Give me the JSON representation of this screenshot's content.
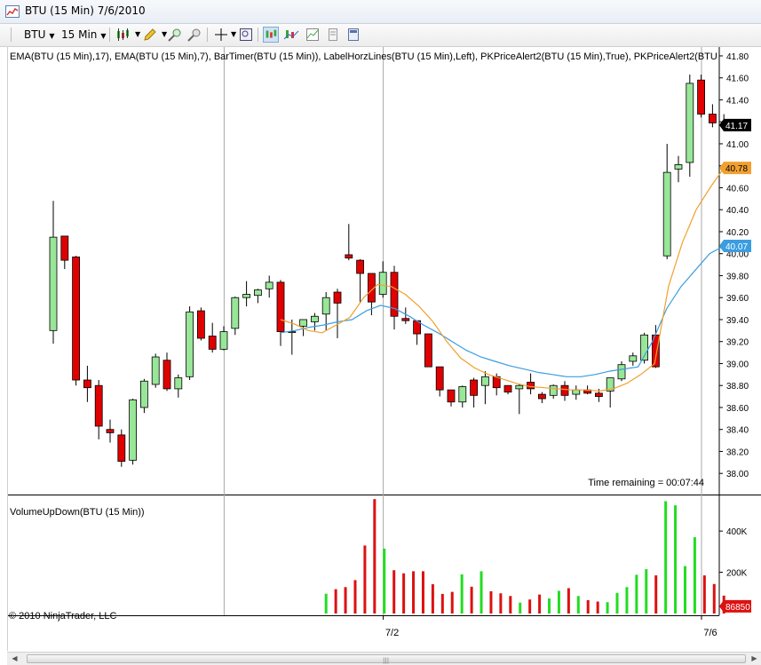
{
  "window": {
    "title": "BTU (15 Min)  7/6/2010"
  },
  "toolbar": {
    "instrument": "BTU",
    "interval": "15 Min"
  },
  "price_panel": {
    "indicator_label": "EMA(BTU (15 Min),17), EMA(BTU (15 Min),7), BarTimer(BTU (15 Min)), LabelHorzLines(BTU (15 Min),Left), PKPriceAlert2(BTU (15 Min),True), PKPriceAlert2(BTU",
    "time_remaining": "Time remaining = 00:07:44",
    "last_price_label": "41.17",
    "ema7_label": "40.78",
    "ema17_label": "40.07",
    "y_ticks": [
      "41.80",
      "41.60",
      "41.40",
      "41.20",
      "41.00",
      "40.80",
      "40.60",
      "40.40",
      "40.20",
      "40.00",
      "39.80",
      "39.60",
      "39.40",
      "39.20",
      "39.00",
      "38.80",
      "38.60",
      "38.40",
      "38.20",
      "38.00"
    ]
  },
  "volume_panel": {
    "label": "VolumeUpDown(BTU (15 Min))",
    "copyright": "© 2010 NinjaTrader, LLC",
    "last_volume_label": "86850",
    "y_ticks": [
      "400K",
      "200K"
    ]
  },
  "x_axis": {
    "labels": [
      "7/2",
      "7/6"
    ]
  },
  "colors": {
    "up": "#98e698",
    "down": "#e00000",
    "ema_fast": "#f0a030",
    "ema_slow": "#3b9de0",
    "vol_up": "#22dd22",
    "vol_down": "#dd1111",
    "last_price_bg": "#000000",
    "ema_fast_bg": "#f0a030",
    "ema_slow_bg": "#3b9de0",
    "volume_label_bg": "#dd1111"
  },
  "chart_data": {
    "type": "candlestick",
    "price_range": [
      37.84,
      41.84
    ],
    "volume_range": [
      0,
      560000
    ],
    "separators": [
      15,
      29,
      57
    ],
    "candles": [
      {
        "o": 39.3,
        "h": 40.48,
        "l": 39.18,
        "c": 40.15
      },
      {
        "o": 40.16,
        "h": 40.16,
        "l": 39.86,
        "c": 39.94
      },
      {
        "o": 39.97,
        "h": 39.98,
        "l": 38.8,
        "c": 38.85
      },
      {
        "o": 38.85,
        "h": 38.98,
        "l": 38.65,
        "c": 38.78
      },
      {
        "o": 38.8,
        "h": 38.85,
        "l": 38.31,
        "c": 38.43
      },
      {
        "o": 38.4,
        "h": 38.49,
        "l": 38.28,
        "c": 38.37
      },
      {
        "o": 38.35,
        "h": 38.4,
        "l": 38.06,
        "c": 38.11
      },
      {
        "o": 38.12,
        "h": 38.68,
        "l": 38.08,
        "c": 38.67
      },
      {
        "o": 38.6,
        "h": 38.86,
        "l": 38.55,
        "c": 38.84
      },
      {
        "o": 38.81,
        "h": 39.09,
        "l": 38.78,
        "c": 39.06
      },
      {
        "o": 39.03,
        "h": 39.1,
        "l": 38.75,
        "c": 38.77
      },
      {
        "o": 38.77,
        "h": 38.9,
        "l": 38.69,
        "c": 38.87
      },
      {
        "o": 38.88,
        "h": 39.52,
        "l": 38.85,
        "c": 39.47
      },
      {
        "o": 39.48,
        "h": 39.51,
        "l": 39.21,
        "c": 39.23
      },
      {
        "o": 39.25,
        "h": 39.37,
        "l": 39.1,
        "c": 39.13
      },
      {
        "o": 39.13,
        "h": 39.34,
        "l": 39.12,
        "c": 39.29
      },
      {
        "o": 39.32,
        "h": 39.61,
        "l": 39.26,
        "c": 39.6
      },
      {
        "o": 39.6,
        "h": 39.75,
        "l": 39.52,
        "c": 39.63
      },
      {
        "o": 39.62,
        "h": 39.68,
        "l": 39.55,
        "c": 39.67
      },
      {
        "o": 39.68,
        "h": 39.8,
        "l": 39.6,
        "c": 39.74
      },
      {
        "o": 39.74,
        "h": 39.76,
        "l": 39.16,
        "c": 39.29
      },
      {
        "o": 39.29,
        "h": 39.4,
        "l": 39.08,
        "c": 39.29
      },
      {
        "o": 39.34,
        "h": 39.4,
        "l": 39.25,
        "c": 39.4
      },
      {
        "o": 39.38,
        "h": 39.46,
        "l": 39.3,
        "c": 39.43
      },
      {
        "o": 39.45,
        "h": 39.65,
        "l": 39.3,
        "c": 39.6
      },
      {
        "o": 39.65,
        "h": 39.68,
        "l": 39.23,
        "c": 39.55
      },
      {
        "o": 39.99,
        "h": 40.27,
        "l": 39.94,
        "c": 39.96
      },
      {
        "o": 39.94,
        "h": 39.95,
        "l": 39.55,
        "c": 39.82
      },
      {
        "o": 39.82,
        "h": 39.82,
        "l": 39.44,
        "c": 39.56
      },
      {
        "o": 39.63,
        "h": 39.93,
        "l": 39.6,
        "c": 39.83
      },
      {
        "o": 39.83,
        "h": 39.89,
        "l": 39.31,
        "c": 39.43
      },
      {
        "o": 39.41,
        "h": 39.51,
        "l": 39.36,
        "c": 39.39
      },
      {
        "o": 39.39,
        "h": 39.39,
        "l": 39.17,
        "c": 39.27
      },
      {
        "o": 39.27,
        "h": 39.27,
        "l": 38.99,
        "c": 38.97
      },
      {
        "o": 38.97,
        "h": 38.97,
        "l": 38.7,
        "c": 38.76
      },
      {
        "o": 38.76,
        "h": 38.76,
        "l": 38.61,
        "c": 38.65
      },
      {
        "o": 38.65,
        "h": 38.8,
        "l": 38.6,
        "c": 38.79
      },
      {
        "o": 38.85,
        "h": 38.87,
        "l": 38.6,
        "c": 38.71
      },
      {
        "o": 38.8,
        "h": 38.93,
        "l": 38.63,
        "c": 38.88
      },
      {
        "o": 38.88,
        "h": 38.91,
        "l": 38.71,
        "c": 38.78
      },
      {
        "o": 38.8,
        "h": 38.8,
        "l": 38.72,
        "c": 38.74
      },
      {
        "o": 38.77,
        "h": 38.81,
        "l": 38.54,
        "c": 38.8
      },
      {
        "o": 38.83,
        "h": 38.91,
        "l": 38.72,
        "c": 38.77
      },
      {
        "o": 38.72,
        "h": 38.74,
        "l": 38.64,
        "c": 38.68
      },
      {
        "o": 38.71,
        "h": 38.81,
        "l": 38.68,
        "c": 38.8
      },
      {
        "o": 38.8,
        "h": 38.84,
        "l": 38.66,
        "c": 38.71
      },
      {
        "o": 38.72,
        "h": 38.8,
        "l": 38.67,
        "c": 38.76
      },
      {
        "o": 38.76,
        "h": 38.8,
        "l": 38.72,
        "c": 38.73
      },
      {
        "o": 38.73,
        "h": 38.77,
        "l": 38.65,
        "c": 38.7
      },
      {
        "o": 38.75,
        "h": 38.87,
        "l": 38.6,
        "c": 38.87
      },
      {
        "o": 38.86,
        "h": 39.02,
        "l": 38.84,
        "c": 38.99
      },
      {
        "o": 39.02,
        "h": 39.1,
        "l": 38.98,
        "c": 39.07
      },
      {
        "o": 39.03,
        "h": 39.28,
        "l": 39.0,
        "c": 39.26
      },
      {
        "o": 39.26,
        "h": 39.35,
        "l": 38.96,
        "c": 38.97
      },
      {
        "o": 39.98,
        "h": 41.0,
        "l": 39.95,
        "c": 40.74
      },
      {
        "o": 40.77,
        "h": 40.89,
        "l": 40.65,
        "c": 40.81
      },
      {
        "o": 40.83,
        "h": 41.63,
        "l": 40.7,
        "c": 41.55
      },
      {
        "o": 41.58,
        "h": 41.63,
        "l": 41.24,
        "c": 41.27
      },
      {
        "o": 41.27,
        "h": 41.36,
        "l": 41.15,
        "c": 41.19
      },
      {
        "o": 41.18,
        "h": 41.27,
        "l": 41.15,
        "c": 41.17
      }
    ],
    "ema_fast": [
      39.4,
      39.36,
      39.3,
      39.28,
      39.35,
      39.42,
      39.6,
      39.72,
      39.7,
      39.63,
      39.52,
      39.38,
      39.2,
      39.05,
      38.96,
      38.9,
      38.86,
      38.82,
      38.79,
      38.78,
      38.77,
      38.76,
      38.76,
      38.75,
      38.77,
      38.82,
      38.9,
      39.0,
      39.7,
      40.1,
      40.4,
      40.6,
      40.78
    ],
    "ema_slow": [
      39.28,
      39.3,
      39.33,
      39.35,
      39.38,
      39.4,
      39.48,
      39.53,
      39.5,
      39.43,
      39.35,
      39.28,
      39.2,
      39.12,
      39.06,
      39.02,
      38.98,
      38.95,
      38.92,
      38.9,
      38.88,
      38.88,
      38.9,
      38.93,
      38.95,
      38.97,
      39.2,
      39.5,
      39.7,
      39.85,
      40.0,
      40.07
    ],
    "volumes": [
      96000,
      118000,
      128000,
      162000,
      330000,
      555000,
      315000,
      210000,
      195000,
      205000,
      205000,
      142000,
      95000,
      105000,
      190000,
      130000,
      205000,
      108000,
      98000,
      85000,
      53000,
      68000,
      92000,
      73000,
      110000,
      123000,
      85000,
      65000,
      58000,
      55000,
      100000,
      128000,
      188000,
      215000,
      185000,
      545000,
      525000,
      230000,
      370000,
      185000,
      143000,
      86850
    ]
  }
}
